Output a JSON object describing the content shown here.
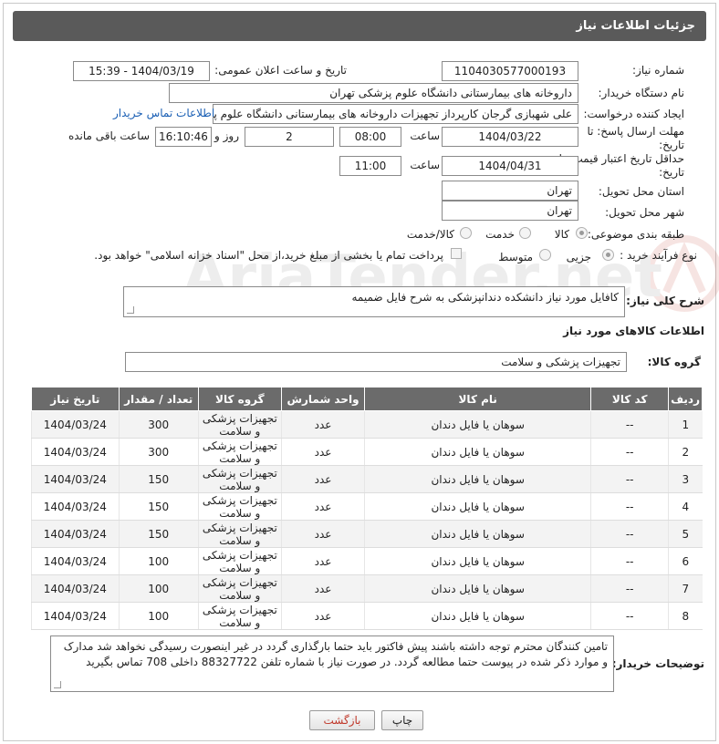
{
  "header": {
    "title": "جزئیات اطلاعات نیاز"
  },
  "fields": {
    "need_number_label": "شماره نیاز:",
    "need_number": "1104030577000193",
    "announce_label": "تاریخ و ساعت اعلان عمومی:",
    "announce_value": "1404/03/19 - 15:39",
    "buyer_org_label": "نام دستگاه خریدار:",
    "buyer_org": "داروخانه های بیمارستانی دانشگاه علوم پزشکی تهران",
    "creator_label": "ایجاد کننده درخواست:",
    "creator": "علی شهبازی گرجان کارپرداز تجهیزات داروخانه های بیمارستانی دانشگاه علوم پزشکی تهران",
    "contact_link": "اطلاعات تماس خریدار",
    "deadline_label": "مهلت ارسال پاسخ: تا تاریخ:",
    "deadline_date": "1404/03/22",
    "time_label": "ساعت",
    "deadline_time": "08:00",
    "days_value": "2",
    "days_label": "روز و",
    "remaining_time": "16:10:46",
    "remaining_label": "ساعت باقی مانده",
    "validity_label": "حداقل تاریخ اعتبار قیمت: تا تاریخ:",
    "validity_date": "1404/04/31",
    "validity_time": "11:00",
    "province_label": "استان محل تحویل:",
    "province": "تهران",
    "city_label": "شهر محل تحویل:",
    "city": "تهران",
    "category_label": "طبقه بندی موضوعی:",
    "category_options": [
      "کالا",
      "خدمت",
      "کالا/خدمت"
    ],
    "process_label": "نوع فرآیند خرید :",
    "process_options": [
      "جزیی",
      "متوسط"
    ],
    "payment_note": "پرداخت تمام یا بخشی از مبلغ خرید،از محل \"اسناد خزانه اسلامی\" خواهد بود.",
    "desc_label": "شرح کلی نیاز:",
    "desc_value": "کافایل مورد نیاز دانشکده دندانپزشکی به شرح فایل ضمیمه",
    "goods_info_title": "اطلاعات کالاهای مورد نیاز",
    "goods_group_label": "گروه کالا:",
    "goods_group": "تجهیزات پزشکی و سلامت",
    "buyer_notes_label": "توضیحات خریدار:",
    "buyer_notes": "تامین کنندگان محترم توجه داشته باشند پیش فاکتور باید حتما بارگذاری گردد در غیر اینصورت رسیدگی نخواهد شد مدارک و موارد ذکر شده در پیوست حتما مطالعه گردد. در صورت نیاز با شماره تلفن 88327722 داخلی 708 تماس بگیرید"
  },
  "table": {
    "headers": [
      "ردیف",
      "کد کالا",
      "نام کالا",
      "واحد شمارش",
      "گروه کالا",
      "تعداد / مقدار",
      "تاریخ نیاز"
    ],
    "rows": [
      [
        "1",
        "--",
        "سوهان یا فایل دندان",
        "عدد",
        "تجهیزات پزشکی و سلامت",
        "300",
        "1404/03/24"
      ],
      [
        "2",
        "--",
        "سوهان یا فایل دندان",
        "عدد",
        "تجهیزات پزشکی و سلامت",
        "300",
        "1404/03/24"
      ],
      [
        "3",
        "--",
        "سوهان یا فایل دندان",
        "عدد",
        "تجهیزات پزشکی و سلامت",
        "150",
        "1404/03/24"
      ],
      [
        "4",
        "--",
        "سوهان یا فایل دندان",
        "عدد",
        "تجهیزات پزشکی و سلامت",
        "150",
        "1404/03/24"
      ],
      [
        "5",
        "--",
        "سوهان یا فایل دندان",
        "عدد",
        "تجهیزات پزشکی و سلامت",
        "150",
        "1404/03/24"
      ],
      [
        "6",
        "--",
        "سوهان یا فایل دندان",
        "عدد",
        "تجهیزات پزشکی و سلامت",
        "100",
        "1404/03/24"
      ],
      [
        "7",
        "--",
        "سوهان یا فایل دندان",
        "عدد",
        "تجهیزات پزشکی و سلامت",
        "100",
        "1404/03/24"
      ],
      [
        "8",
        "--",
        "سوهان یا فایل دندان",
        "عدد",
        "تجهیزات پزشکی و سلامت",
        "100",
        "1404/03/24"
      ]
    ]
  },
  "buttons": {
    "print": "چاپ",
    "back": "بازگشت"
  },
  "watermark": {
    "text": "AriaTender.net"
  },
  "colors": {
    "header_bg": "#5a5a5a",
    "table_header_bg": "#6b6b6b",
    "link": "#1a5fb4",
    "back_text": "#c0392b"
  }
}
